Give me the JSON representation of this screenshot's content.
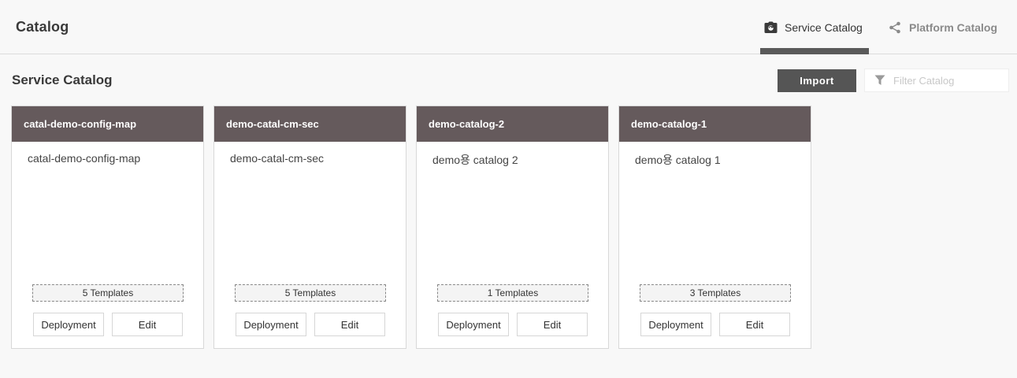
{
  "header": {
    "title": "Catalog",
    "tabs": [
      {
        "label": "Service Catalog",
        "icon": "camera-icon",
        "active": true
      },
      {
        "label": "Platform Catalog",
        "icon": "share-icon",
        "active": false
      }
    ]
  },
  "toolbar": {
    "section_title": "Service Catalog",
    "import_label": "Import",
    "filter_placeholder": "Filter Catalog"
  },
  "cards": [
    {
      "name": "catal-demo-config-map",
      "description": "catal-demo-config-map",
      "templates": "5 Templates",
      "deploy_label": "Deployment",
      "edit_label": "Edit"
    },
    {
      "name": "demo-catal-cm-sec",
      "description": "demo-catal-cm-sec",
      "templates": "5 Templates",
      "deploy_label": "Deployment",
      "edit_label": "Edit"
    },
    {
      "name": "demo-catalog-2",
      "description": "demo용 catalog 2",
      "templates": "1 Templates",
      "deploy_label": "Deployment",
      "edit_label": "Edit"
    },
    {
      "name": "demo-catalog-1",
      "description": "demo용 catalog 1",
      "templates": "3 Templates",
      "deploy_label": "Deployment",
      "edit_label": "Edit"
    }
  ],
  "colors": {
    "card_header": "#655a5c",
    "import_button": "#555555",
    "active_tab_underline": "#5a5a5a"
  }
}
